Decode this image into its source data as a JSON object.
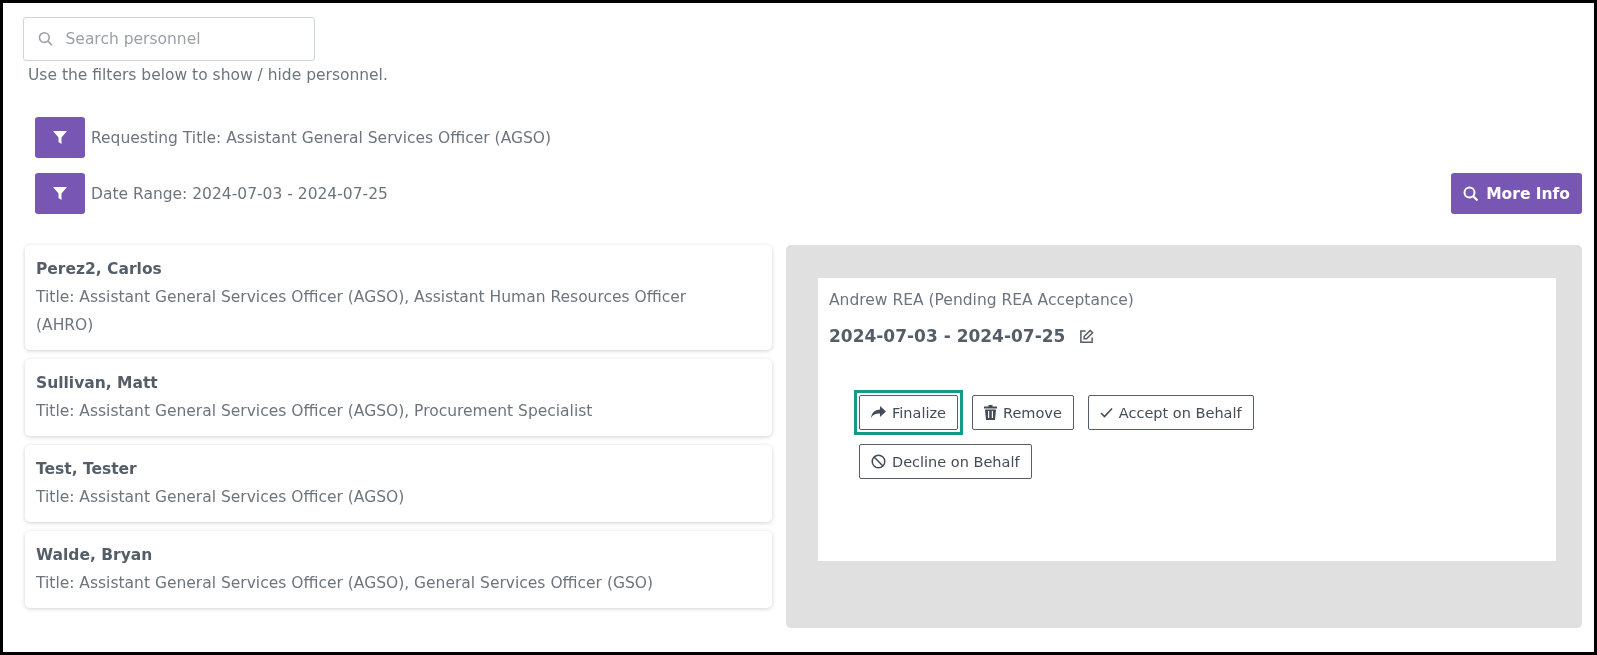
{
  "search": {
    "placeholder": "Search personnel"
  },
  "filter_hint": "Use the filters below to show / hide personnel.",
  "filters": [
    {
      "label": "Requesting Title: Assistant General Services Officer (AGSO)"
    },
    {
      "label": "Date Range: 2024-07-03 - 2024-07-25"
    }
  ],
  "more_info_button": "More Info",
  "personnel": [
    {
      "name": "Perez2, Carlos",
      "title": "Title: Assistant General Services Officer (AGSO), Assistant Human Resources Officer (AHRO)"
    },
    {
      "name": "Sullivan, Matt",
      "title": "Title: Assistant General Services Officer (AGSO), Procurement Specialist"
    },
    {
      "name": "Test, Tester",
      "title": "Title: Assistant General Services Officer (AGSO)"
    },
    {
      "name": "Walde, Bryan",
      "title": "Title: Assistant General Services Officer (AGSO), General Services Officer (GSO)"
    }
  ],
  "detail": {
    "heading": "Andrew REA (Pending REA Acceptance)",
    "date_range": "2024-07-03 - 2024-07-25",
    "actions": [
      {
        "label": "Finalize",
        "kind": "share",
        "highlighted": true
      },
      {
        "label": "Remove",
        "kind": "trash",
        "highlighted": false
      },
      {
        "label": "Accept on Behalf",
        "kind": "check",
        "highlighted": false
      },
      {
        "label": "Decline on Behalf",
        "kind": "ban",
        "highlighted": false
      }
    ]
  }
}
